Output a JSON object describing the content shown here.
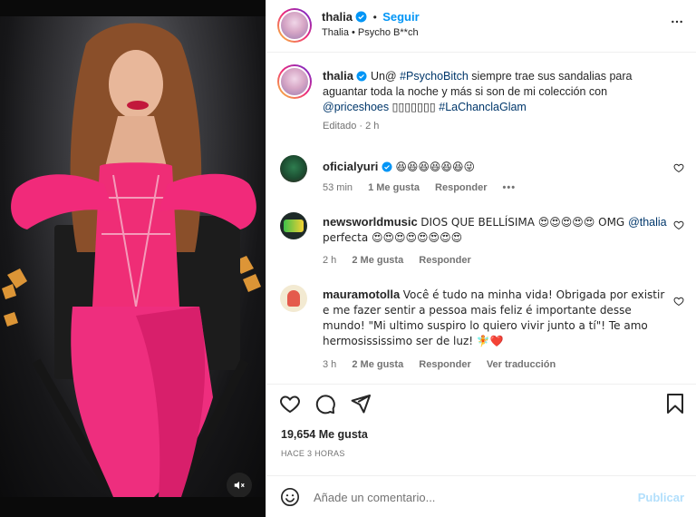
{
  "post": {
    "author": "thalia",
    "follow_label": "Seguir",
    "separator": "•",
    "audio": "Thalia • Psycho B**ch"
  },
  "caption": {
    "author": "thalia",
    "text_start": "Un@ ",
    "hashtag1": "#PsychoBitch",
    "text_mid": " siempre trae sus sandalias para aguantar toda la noche y más si son de mi colección con ",
    "mention": "@priceshoes",
    "boxes": "▯▯▯▯▯▯▯",
    "hashtag2": "#LaChanclaGlam",
    "meta": "Editado · 2 h"
  },
  "comments": [
    {
      "author": "oficialyuri",
      "text": "😆😆😆😆😆😆😜",
      "time": "53 min",
      "likes": "1 Me gusta",
      "reply": "Responder",
      "more": "•••"
    },
    {
      "author": "newsworldmusic",
      "text_a": "DIOS QUE BELLÍSIMA 😍😍😍😍😍 OMG ",
      "mention": "@thalia",
      "text_b": " perfecta 😍😍😍😍😍😍😍😍",
      "time": "2 h",
      "likes": "2 Me gusta",
      "reply": "Responder"
    },
    {
      "author": "mauramotolla",
      "text": "Você é tudo na minha vida! Obrigada por existir e me fazer sentir a pessoa mais feliz é importante desse mundo! \"Mi ultimo suspiro lo quiero vivir junto a tí\"! Te amo hermosississimo ser de luz! 🧚❤️",
      "time": "3 h",
      "likes": "2 Me gusta",
      "reply": "Responder",
      "translate": "Ver traducción"
    }
  ],
  "actions": {
    "likes_count": "19,654 Me gusta",
    "time_ago": "HACE 3 HORAS"
  },
  "composer": {
    "emoji_icon": "smiley-icon",
    "placeholder": "Añade un comentario...",
    "publish_label": "Publicar"
  },
  "colors": {
    "accent": "#0095f6",
    "verified": "#0095f6",
    "link": "#00376b",
    "muted": "#737373",
    "heart": "#ed4956"
  }
}
